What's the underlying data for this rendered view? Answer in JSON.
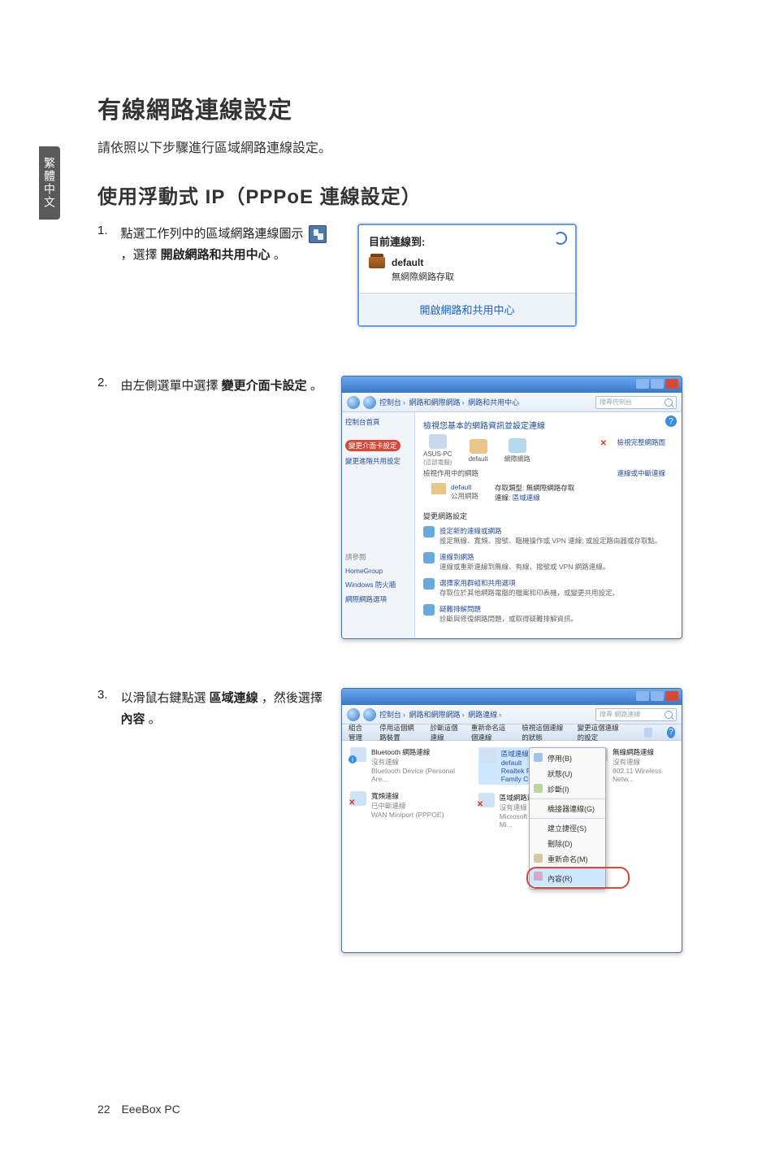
{
  "sideTab": "繁體中文",
  "h1": "有線網路連線設定",
  "intro": "請依照以下步驟進行區域網路連線設定。",
  "h2": "使用浮動式 IP（PPPoE 連線設定）",
  "step1": {
    "num": "1.",
    "textA": "點選工作列中的區域網路連線圖示",
    "textB": "，選擇 ",
    "bold": "開啟網路和共用中心",
    "textC": "。"
  },
  "popup": {
    "head": "目前連線到:",
    "network": "default",
    "access": "無網際網路存取",
    "link": "開啟網路和共用中心"
  },
  "step2": {
    "num": "2.",
    "textA": "由左側選單中選擇 ",
    "bold": "變更介面卡設定",
    "textC": "。"
  },
  "win2": {
    "crumb1": "控制台",
    "crumb2": "網路和網際網路",
    "crumb3": "網路和共用中心",
    "searchPlaceholder": "搜尋控制台",
    "side": {
      "home": "控制台首頁",
      "changeAdapter": "變更介面卡設定",
      "changeSharing": "變更進階共用設定",
      "seeAlso": "請參閱",
      "homegroup": "HomeGroup",
      "firewall": "Windows 防火牆",
      "internetOptions": "網際網路選項"
    },
    "main": {
      "title": "檢視您基本的網路資訊並設定連線",
      "pc": "ASUS-PC",
      "pcSub": "(這部電腦)",
      "net": "default",
      "internet": "網際網路",
      "fullMap": "檢視完整網路圖",
      "connectLink": "連線或中斷連線",
      "activeTitle": "檢視作用中的網路",
      "activeName": "default",
      "activeType": "公用網路",
      "accessTypeL": "存取類型:",
      "accessTypeV": "無網際網路存取",
      "connectionsL": "連線:",
      "connectionsV": "區域連線",
      "changeTitle": "變更網路設定",
      "e1t": "設定新的連線或網路",
      "e1d": "設定無線、寬頻、撥號、臨機操作或 VPN 連線; 或設定路由器或存取點。",
      "e2t": "連線到網路",
      "e2d": "連線或重新連線到無線、有線、撥號或 VPN 網路連線。",
      "e3t": "選擇家用群組和共用選項",
      "e3d": "存取位於其他網路電腦的檔案和印表機，或變更共用設定。",
      "e4t": "疑難排解問題",
      "e4d": "診斷與修復網路問題，或取得疑難排解資訊。"
    }
  },
  "step3": {
    "num": "3.",
    "textA": "以滑鼠右鍵點選 ",
    "bold1": "區域連線",
    "textB": "，然後選擇 ",
    "bold2": "內容",
    "textC": "。"
  },
  "win3": {
    "crumb1": "控制台",
    "crumb2": "網路和網際網路",
    "crumb3": "網路連線",
    "searchPlaceholder": "搜尋 網路連線",
    "menu": {
      "organize": "組合管理",
      "disableDev": "停用這個網路裝置",
      "diagnose": "診斷這個連線",
      "rename": "重新命名這個連線",
      "viewStatus": "檢視這個連線的狀態",
      "changeSettings": "變更這個連線的設定"
    },
    "conns": {
      "c1a": "Bluetooth 網路連線",
      "c1b": "沒有連線",
      "c1c": "Bluetooth Device (Personal Are...",
      "c2a": "區域連線",
      "c2b": "default",
      "c2c": "Realtek PCIe GBE Family C...",
      "c3a": "寬頻連線",
      "c3b": "已中斷連線",
      "c3c": "WAN Miniport (PPPOE)",
      "c4a": "區域網路連線 2",
      "c4b": "沒有連線",
      "c4c": "Microsoft Virtual WiFi Mi...",
      "c5a": "無線網路連線",
      "c5b": "沒有連線",
      "c5c": "802.11 Wireless Netw..."
    },
    "ctx": {
      "disable": "停用(B)",
      "status": "狀態(U)",
      "diagnose": "診斷(I)",
      "bridge": "橋接器連線(G)",
      "shortcut": "建立捷徑(S)",
      "delete": "刪除(D)",
      "rename": "重新命名(M)",
      "properties": "內容(R)"
    }
  },
  "footer": {
    "page": "22",
    "product": "EeeBox PC"
  }
}
